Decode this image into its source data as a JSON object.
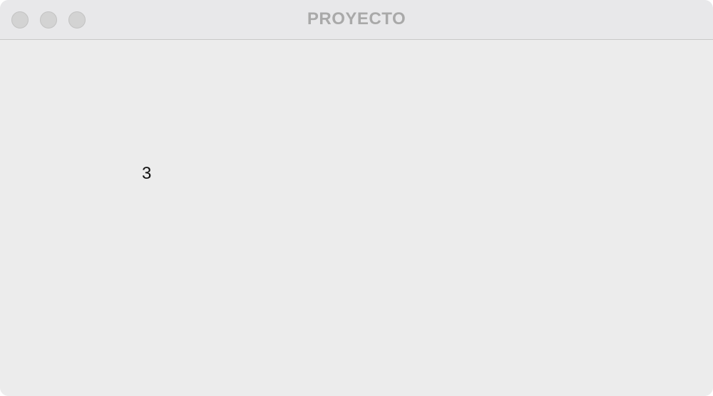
{
  "window": {
    "title": "PROYECTO"
  },
  "content": {
    "value": "3"
  },
  "colors": {
    "background": "#ececec",
    "titlebar": "#e8e8ea",
    "title_text": "#a9a9a9",
    "traffic_light": "#d3d3d3"
  }
}
